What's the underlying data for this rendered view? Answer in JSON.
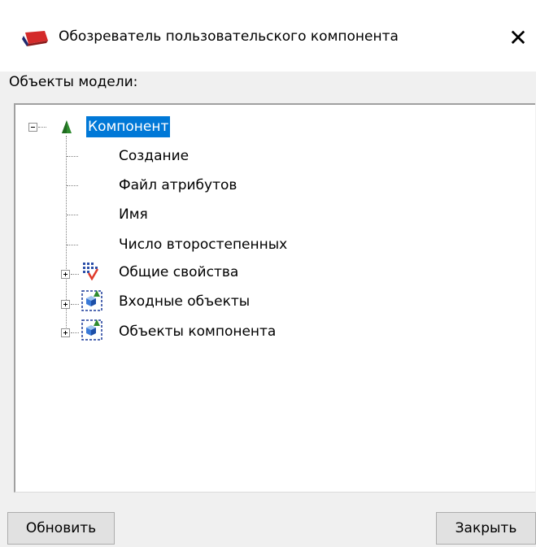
{
  "window": {
    "title": "Обозреватель пользовательского компонента",
    "close_glyph": "✕",
    "app_icon": "red-book-icon"
  },
  "panel": {
    "label": "Объекты модели:"
  },
  "tree": {
    "root": {
      "label": "Компонент",
      "icon": "green-triangle-icon",
      "expanded": true,
      "selected": true
    },
    "attributes": [
      {
        "label": "Создание"
      },
      {
        "label": "Файл атрибутов"
      },
      {
        "label": "Имя"
      },
      {
        "label": "Число второстепенных"
      }
    ],
    "groups": [
      {
        "label": "Общие свойства",
        "icon": "properties-list-icon",
        "expanded": false
      },
      {
        "label": "Входные объекты",
        "icon": "component-objects-icon",
        "expanded": false
      },
      {
        "label": "Объекты компонента",
        "icon": "component-objects-icon",
        "expanded": false
      }
    ]
  },
  "buttons": {
    "refresh_label": "Обновить",
    "close_label": "Закрыть"
  },
  "colors": {
    "selection": "#0078d7",
    "background": "#f0f0f0",
    "tree_background": "#ffffff"
  }
}
